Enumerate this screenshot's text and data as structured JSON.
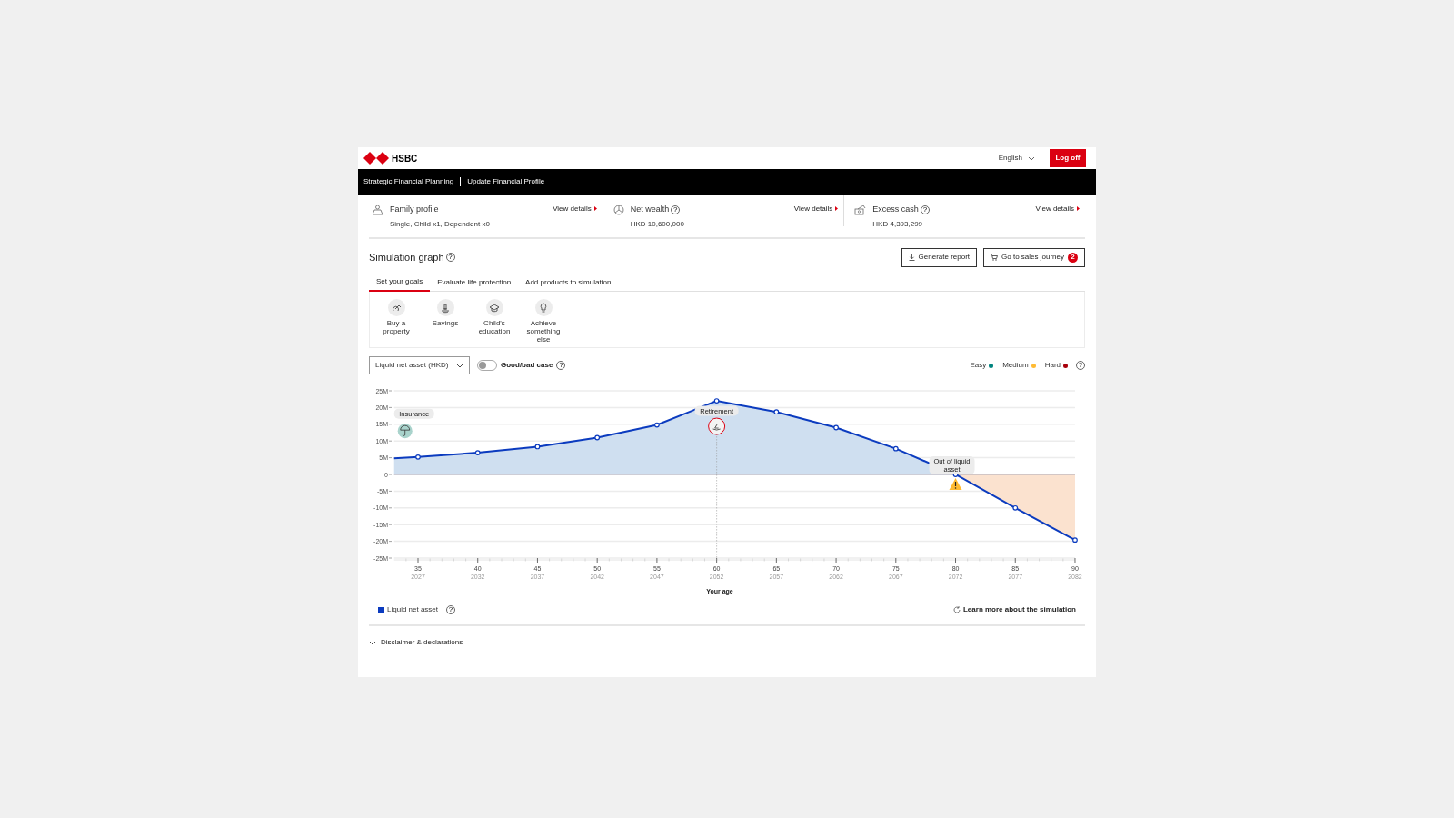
{
  "header": {
    "brand": "HSBC",
    "language": "English",
    "logoff": "Log off"
  },
  "nav": [
    "Strategic Financial Planning",
    "Update Financial Profile"
  ],
  "summary": [
    {
      "kind": "family",
      "title": "Family profile",
      "value": "Single, Child x1, Dependent x0",
      "link": "View details"
    },
    {
      "kind": "wealth",
      "title": "Net wealth",
      "help": "?",
      "value": "HKD 10,600,000",
      "link": "View details"
    },
    {
      "kind": "cash",
      "title": "Excess cash",
      "help": "?",
      "value": "HKD 4,393,299",
      "link": "View details"
    }
  ],
  "simulation": {
    "title": "Simulation graph",
    "help": "?",
    "buttons": [
      {
        "label": "Generate report",
        "kind": "download"
      },
      {
        "label": "Go to sales journey",
        "kind": "cart",
        "badge": "2"
      }
    ]
  },
  "tabs": [
    {
      "label": "Set your goals",
      "selected": true
    },
    {
      "label": "Evaluate life protection",
      "selected": false
    },
    {
      "label": "Add products to simulation",
      "selected": false
    }
  ],
  "goals": [
    {
      "kind": "property",
      "label": "Buy a property"
    },
    {
      "kind": "savings",
      "label": "Savings"
    },
    {
      "kind": "education",
      "label": "Child's education"
    },
    {
      "kind": "other",
      "label": "Achieve something else"
    }
  ],
  "controls": {
    "dropdown": {
      "value": "Liquid net asset (HKD)"
    },
    "toggle": {
      "label": "Good/bad case",
      "on": false,
      "help": "?"
    }
  },
  "difficulty": [
    {
      "label": "Easy",
      "color": "#00847f"
    },
    {
      "label": "Medium",
      "color": "#ffbb33"
    },
    {
      "label": "Hard",
      "color": "#a8000b"
    }
  ],
  "difficulty_help": "?",
  "graph": {
    "chart_data": {
      "type": "area",
      "xlabel": "Your age",
      "grid": true,
      "x": [
        33,
        35,
        40,
        45,
        50,
        55,
        60,
        65,
        70,
        75,
        80,
        85,
        90
      ],
      "series": [
        {
          "name": "Liquid net asset",
          "color": "#0b3bbf",
          "values": [
            4.8,
            5.2,
            6.5,
            8.3,
            11,
            14.8,
            22,
            18.7,
            14,
            7.7,
            0,
            -10,
            -19.6
          ]
        }
      ],
      "xlim": [
        33,
        90
      ],
      "ylim": [
        -25,
        25
      ],
      "xticks": [
        35,
        40,
        45,
        50,
        55,
        60,
        65,
        70,
        75,
        80,
        85,
        90
      ],
      "yticks": [
        {
          "value": 25,
          "label": "25M"
        },
        {
          "value": 20,
          "label": "20M"
        },
        {
          "value": 15,
          "label": "15M"
        },
        {
          "value": 10,
          "label": "10M"
        },
        {
          "value": 5,
          "label": "5M"
        },
        {
          "value": 0,
          "label": "0"
        },
        {
          "value": -5,
          "label": "-5M"
        },
        {
          "value": -10,
          "label": "-10M"
        },
        {
          "value": -15,
          "label": "-15M"
        },
        {
          "value": -20,
          "label": "-20M"
        },
        {
          "value": -25,
          "label": "-25M"
        }
      ]
    },
    "markers": [
      {
        "kind": "insurance",
        "text": "Insurance"
      },
      {
        "kind": "retirement",
        "text": "Retirement"
      },
      {
        "kind": "warning",
        "text": "Out of liquid asset"
      }
    ],
    "year_labels": [
      "2027",
      "2032",
      "2037",
      "2042",
      "2047",
      "2052",
      "2057",
      "2062",
      "2067",
      "2072",
      "2077",
      "2082"
    ],
    "legend_help": "?",
    "learn_more": "Learn more about the simulation"
  },
  "disclaimer": {
    "label": "Disclaimer & declarations",
    "expanded": false
  }
}
